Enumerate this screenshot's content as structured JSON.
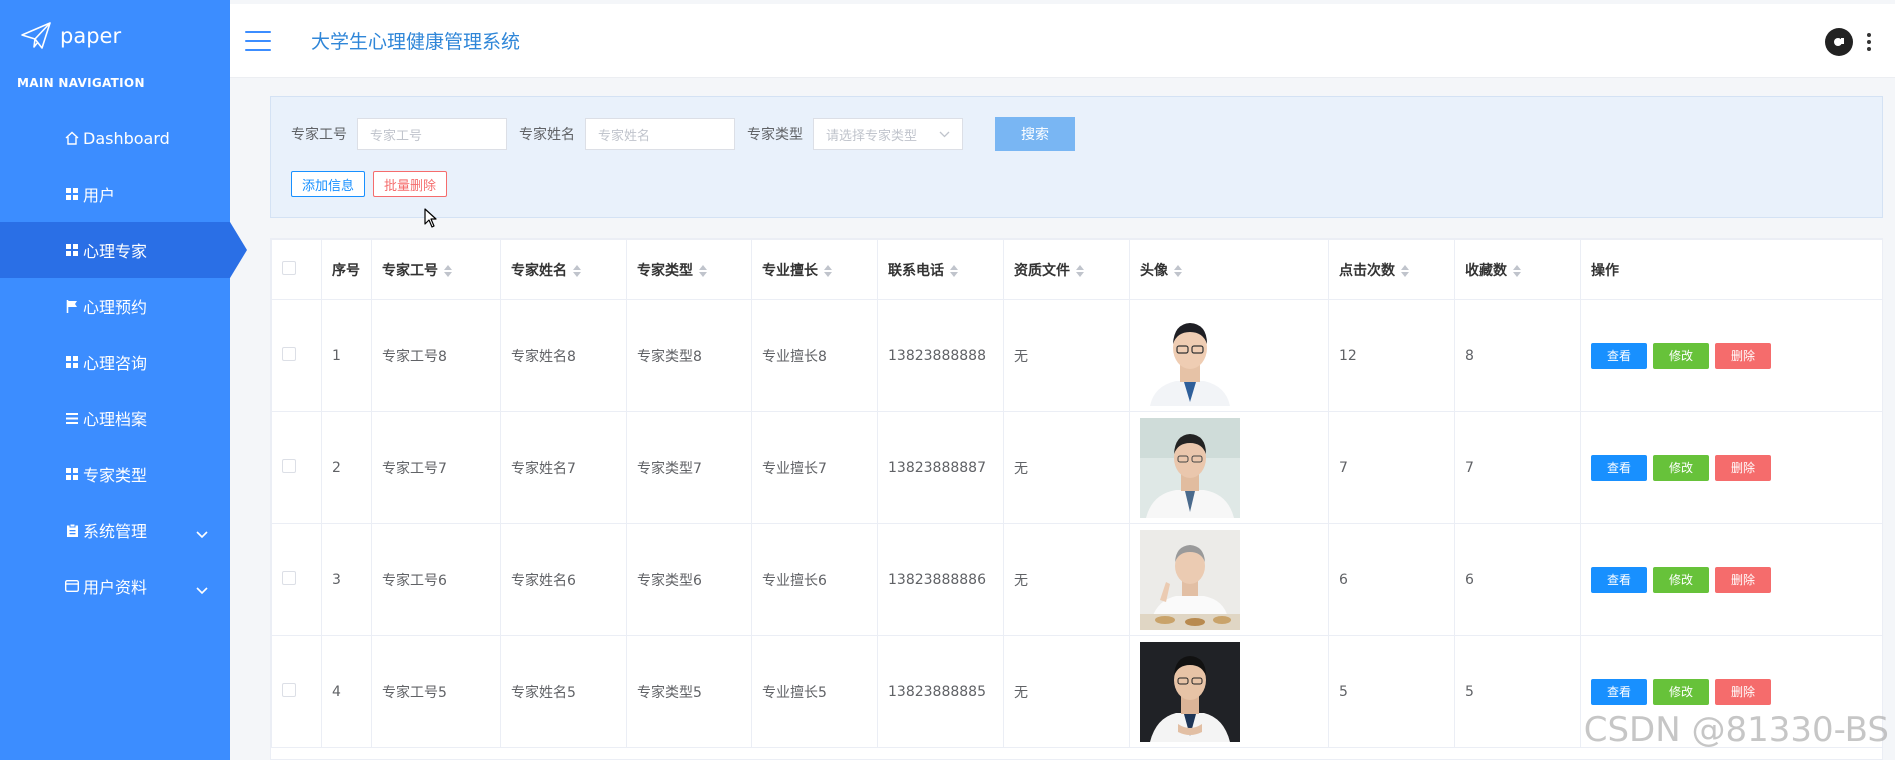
{
  "brand": {
    "name": "paper"
  },
  "sidebar": {
    "header": "MAIN NAVIGATION",
    "items": [
      {
        "label": "Dashboard",
        "icon": "home-icon"
      },
      {
        "label": "用户",
        "icon": "grid-icon"
      },
      {
        "label": "心理专家",
        "icon": "grid-icon",
        "active": true
      },
      {
        "label": "心理预约",
        "icon": "flag-icon"
      },
      {
        "label": "心理咨询",
        "icon": "grid-icon"
      },
      {
        "label": "心理档案",
        "icon": "list-icon"
      },
      {
        "label": "专家类型",
        "icon": "grid-icon"
      },
      {
        "label": "系统管理",
        "icon": "clipboard-icon",
        "expandable": true
      },
      {
        "label": "用户资料",
        "icon": "card-icon",
        "expandable": true
      }
    ]
  },
  "header": {
    "title": "大学生心理健康管理系统"
  },
  "search": {
    "id_label": "专家工号",
    "id_placeholder": "专家工号",
    "name_label": "专家姓名",
    "name_placeholder": "专家姓名",
    "type_label": "专家类型",
    "type_placeholder": "请选择专家类型",
    "search_button": "搜索",
    "add_button": "添加信息",
    "batch_delete_button": "批量删除"
  },
  "table": {
    "headers": [
      "序号",
      "专家工号",
      "专家姓名",
      "专家类型",
      "专业擅长",
      "联系电话",
      "资质文件",
      "头像",
      "点击次数",
      "收藏数",
      "操作"
    ],
    "actions": {
      "view": "查看",
      "edit": "修改",
      "delete": "删除"
    },
    "rows": [
      {
        "no": "1",
        "id": "专家工号8",
        "name": "专家姓名8",
        "type": "专家类型8",
        "specialty": "专业擅长8",
        "phone": "13823888888",
        "file": "无",
        "clicks": "12",
        "favorites": "8"
      },
      {
        "no": "2",
        "id": "专家工号7",
        "name": "专家姓名7",
        "type": "专家类型7",
        "specialty": "专业擅长7",
        "phone": "13823888887",
        "file": "无",
        "clicks": "7",
        "favorites": "7"
      },
      {
        "no": "3",
        "id": "专家工号6",
        "name": "专家姓名6",
        "type": "专家类型6",
        "specialty": "专业擅长6",
        "phone": "13823888886",
        "file": "无",
        "clicks": "6",
        "favorites": "6"
      },
      {
        "no": "4",
        "id": "专家工号5",
        "name": "专家姓名5",
        "type": "专家类型5",
        "specialty": "专业擅长5",
        "phone": "13823888885",
        "file": "无",
        "clicks": "5",
        "favorites": "5"
      }
    ]
  },
  "watermark": "CSDN @81330-BS",
  "colors": {
    "sidebar": "#3c8dff",
    "sidebar_active": "#2a6fe6",
    "title": "#2f86d8",
    "view": "#1890ff",
    "edit": "#67c23a",
    "delete": "#f56c6c"
  }
}
